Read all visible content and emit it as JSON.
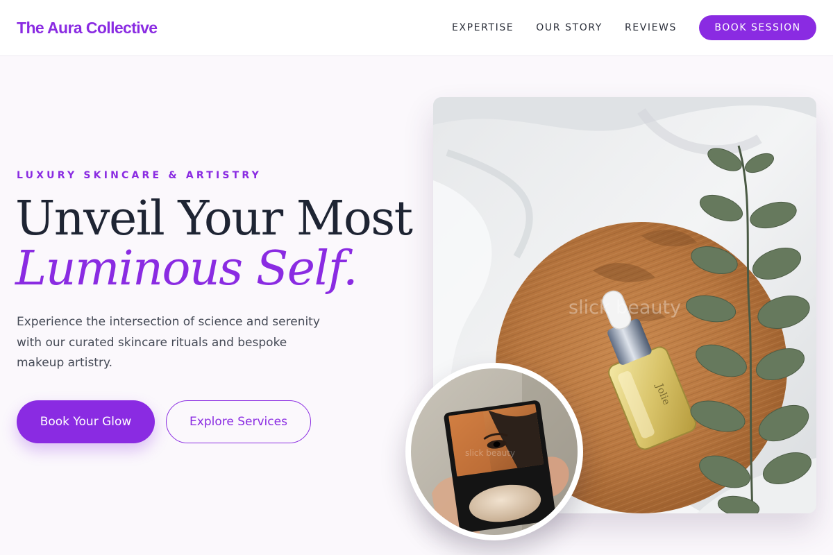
{
  "brand": {
    "name": "The Aura Collective"
  },
  "nav": {
    "links": [
      "EXPERTISE",
      "OUR STORY",
      "REVIEWS"
    ],
    "cta_label": "BOOK SESSION"
  },
  "hero": {
    "eyebrow": "LUXURY SKINCARE & ARTISTRY",
    "headline_line1": "Unveil Your Most",
    "headline_line2": "Luminous Self.",
    "lede": "Experience the intersection of science and serenity with our curated skincare rituals and bespoke makeup artistry.",
    "primary_cta": "Book Your Glow",
    "secondary_cta": "Explore Services"
  },
  "images": {
    "main_watermark": "slick beauty",
    "inset_watermark": "slick beauty",
    "bottle_label": "Jolie"
  },
  "colors": {
    "accent": "#8a2be2",
    "heading": "#1e2433",
    "body_text": "#454a56",
    "page_bg": "#fbf8fc"
  },
  "icons": []
}
